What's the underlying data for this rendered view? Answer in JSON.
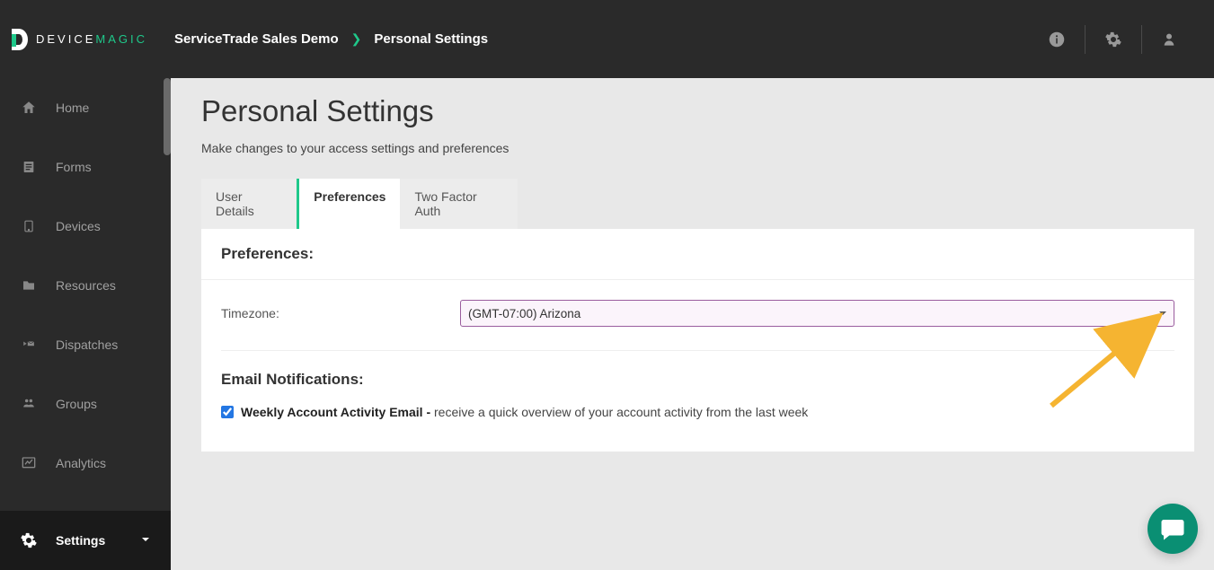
{
  "brand": {
    "name_a": "DEVICE",
    "name_b": "MAGIC"
  },
  "breadcrumb": {
    "org": "ServiceTrade Sales Demo",
    "page": "Personal Settings"
  },
  "sidebar": {
    "items": [
      {
        "label": "Home"
      },
      {
        "label": "Forms"
      },
      {
        "label": "Devices"
      },
      {
        "label": "Resources"
      },
      {
        "label": "Dispatches"
      },
      {
        "label": "Groups"
      },
      {
        "label": "Analytics"
      },
      {
        "label": "Settings"
      }
    ]
  },
  "page": {
    "title": "Personal Settings",
    "subtitle": "Make changes to your access settings and preferences"
  },
  "tabs": [
    {
      "label": "User Details"
    },
    {
      "label": "Preferences"
    },
    {
      "label": "Two Factor Auth"
    }
  ],
  "prefs": {
    "section_title": "Preferences:",
    "timezone_label": "Timezone:",
    "timezone_value": "(GMT-07:00) Arizona",
    "email_section_title": "Email Notifications:",
    "weekly_label": "Weekly Account Activity Email - ",
    "weekly_desc": "receive a quick overview of your account activity from the last week"
  }
}
